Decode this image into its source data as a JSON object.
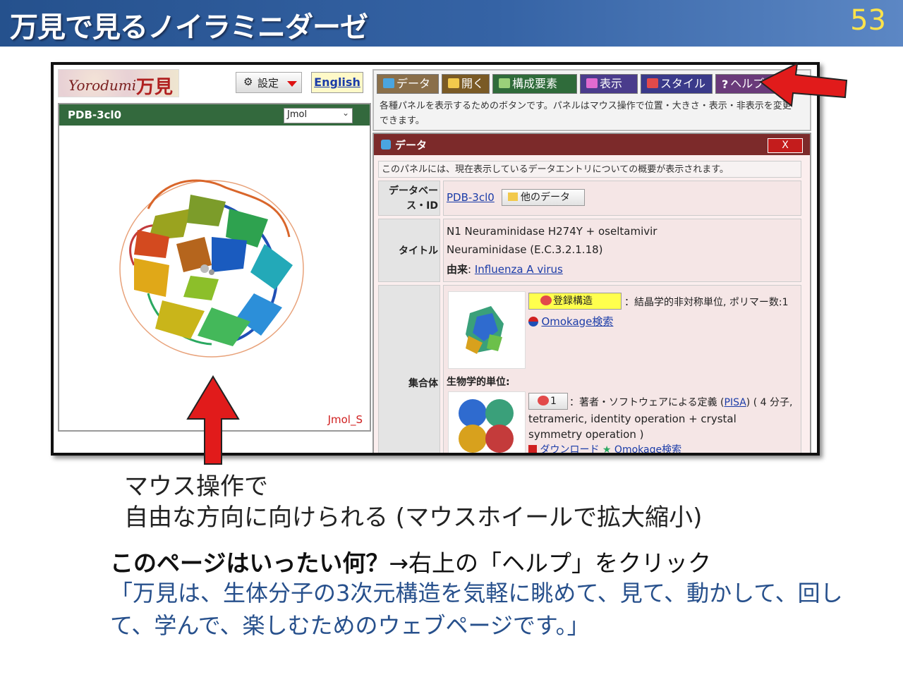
{
  "slide": {
    "title": "万見で見るノイラミニダーゼ",
    "page_number": "53"
  },
  "app": {
    "logo_en": "Yorodumi",
    "logo_jp": "万見",
    "settings_label": "設定",
    "language_label": "English",
    "viewer": {
      "title": "PDB-3cl0",
      "renderer": "Jmol",
      "footer": "Jmol_S"
    }
  },
  "toolbar": {
    "buttons": [
      {
        "label": "データ",
        "color": "#8a6f4a"
      },
      {
        "label": "開く",
        "color": "#7a5a25"
      },
      {
        "label": "構成要素",
        "color": "#2f6b3a"
      },
      {
        "label": "表示",
        "color": "#4a3c8c"
      },
      {
        "label": "スタイル",
        "color": "#3a3a8a"
      },
      {
        "label": "ヘルプ",
        "color": "#6a3a7a"
      }
    ],
    "description": "各種パネルを表示するためのボタンです。パネルはマウス操作で位置・大きさ・表示・非表示を変更できます。"
  },
  "data_panel": {
    "title": "データ",
    "close_label": "X",
    "description": "このパネルには、現在表示しているデータエントリについての概要が表示されます。",
    "db_id_header": "データベース・ID",
    "db_id_value": "PDB-3cl0",
    "other_data_label": "他のデータ",
    "title_header": "タイトル",
    "title_line1": "N1 Neuraminidase H274Y + oseltamivir",
    "title_line2": "Neuraminidase (E.C.3.2.1.18)",
    "source_label": "由来",
    "source_value": "Influenza A virus",
    "assembly_header": "集合体",
    "registered_structure_label": "登録構造",
    "registered_structure_text": "：結晶学的非対称単位, ポリマー数:1",
    "omokage_label": "Omokage検索",
    "bio_unit_label": "生物学的単位:",
    "bio_unit_num": "1",
    "bio_unit_text_pre": "：著者・ソフトウェアによる定義 (",
    "pisa_label": "PISA",
    "bio_unit_text_post": ") ( 4 分子,",
    "bio_unit_line2": "tetrameric, identity operation + crystal",
    "bio_unit_line3": "symmetry operation )",
    "download_label": "ダウンロード",
    "omokage_label2": "Omokage検索"
  },
  "caption": {
    "line1": "マウス操作で",
    "line2": "自由な方向に向けられる (マウスホイールで拡大縮小)"
  },
  "question": {
    "bold": "このページはいったい何？",
    "rest": "→右上の「ヘルプ」をクリック"
  },
  "answer": "「万見は、生体分子の3次元構造を気軽に眺めて、見て、動かして、回して、学んで、楽しむためのウェブページです。」"
}
